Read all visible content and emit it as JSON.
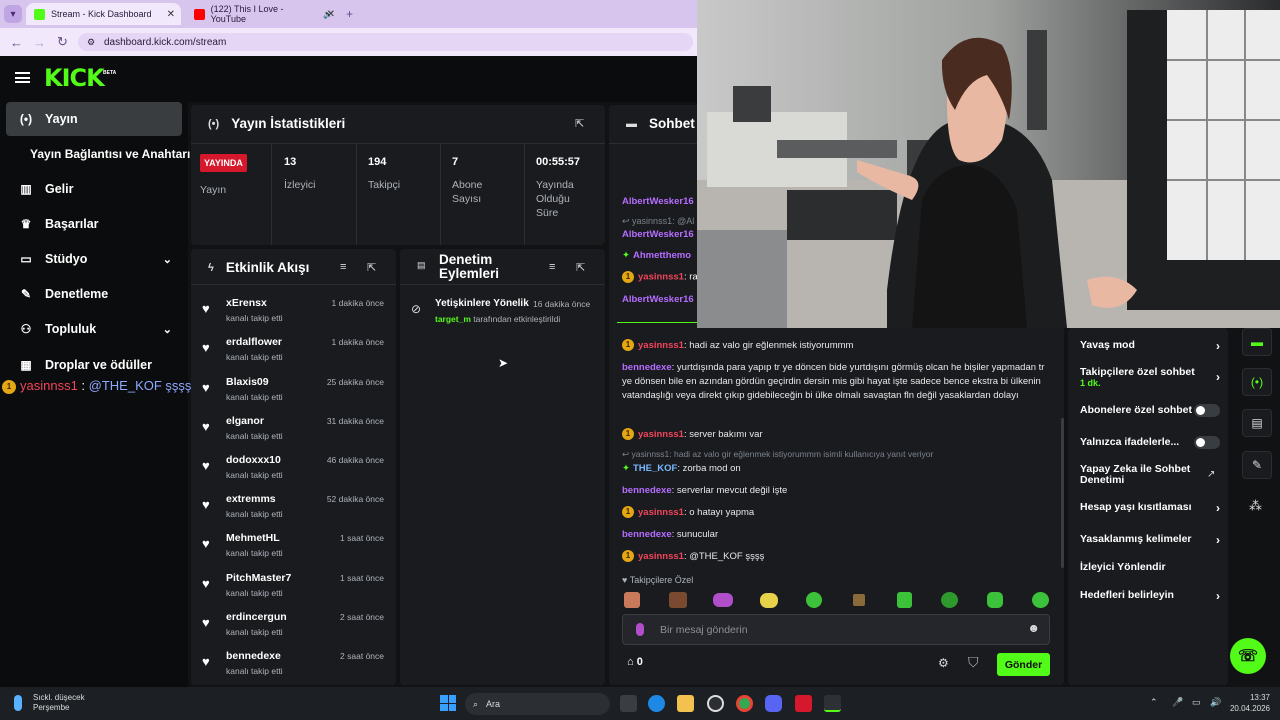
{
  "browser": {
    "tabs": [
      {
        "title": "Stream - Kick Dashboard",
        "active": true
      },
      {
        "title": "(122) This I Love - YouTube",
        "active": false
      }
    ],
    "url": "dashboard.kick.com/stream"
  },
  "brand": {
    "logo": "KICK",
    "beta": "BETA",
    "accent": "#53fc18"
  },
  "sidebar": {
    "items": [
      {
        "label": "Yayın",
        "icon": "broadcast-icon"
      },
      {
        "label": "Yayın Bağlantısı ve Anahtarı",
        "icon": ""
      },
      {
        "label": "Gelir",
        "icon": "bar-chart-icon"
      },
      {
        "label": "Başarılar",
        "icon": "trophy-icon"
      },
      {
        "label": "Stüdyo",
        "icon": "studio-icon"
      },
      {
        "label": "Denetleme",
        "icon": "wrench-icon"
      },
      {
        "label": "Topluluk",
        "icon": "users-icon"
      },
      {
        "label": "Droplar ve ödüller",
        "icon": "gift-icon"
      }
    ]
  },
  "overlay_chat": {
    "user": "yasinnss1",
    "sep": " : ",
    "text": "@THE_KOF şşşş"
  },
  "stats": {
    "title": "Yayın İstatistikleri",
    "live_badge": "YAYINDA",
    "live_label": "Yayın",
    "items": [
      {
        "value": "13",
        "label": "İzleyici"
      },
      {
        "value": "194",
        "label": "Takipçi"
      },
      {
        "value": "7",
        "label": "Abone Sayısı"
      },
      {
        "value": "00:55:57",
        "label": "Yayında Olduğu Süre"
      }
    ]
  },
  "activity": {
    "title": "Etkinlik Akışı",
    "items": [
      {
        "name": "xErensx",
        "sub": "kanalı takip etti",
        "time": "1 dakika önce"
      },
      {
        "name": "erdalflower",
        "sub": "kanalı takip etti",
        "time": "1 dakika önce"
      },
      {
        "name": "Blaxis09",
        "sub": "kanalı takip etti",
        "time": "25 dakika önce"
      },
      {
        "name": "elganor",
        "sub": "kanalı takip etti",
        "time": "31 dakika önce"
      },
      {
        "name": "dodoxxx10",
        "sub": "kanalı takip etti",
        "time": "46 dakika önce"
      },
      {
        "name": "extremms",
        "sub": "kanalı takip etti",
        "time": "52 dakika önce"
      },
      {
        "name": "MehmetHL",
        "sub": "kanalı takip etti",
        "time": "1 saat önce"
      },
      {
        "name": "PitchMaster7",
        "sub": "kanalı takip etti",
        "time": "1 saat önce"
      },
      {
        "name": "erdincergun",
        "sub": "kanalı takip etti",
        "time": "2 saat önce"
      },
      {
        "name": "bennedexe",
        "sub": "kanalı takip etti",
        "time": "2 saat önce"
      }
    ]
  },
  "moderation": {
    "title_line1": "Denetim",
    "title_line2": "Eylemleri",
    "item": {
      "title": "Yetişkinlere Yönelik",
      "time": "16 dakika önce",
      "actor": "target_m",
      "action": " tarafından etkinleştirildi"
    }
  },
  "chat": {
    "title": "Sohbet",
    "top_cut": [
      {
        "text": "AlbertWesker16"
      },
      {
        "reply": "yasinnss1: @Al"
      },
      {
        "user": "AlbertWesker16"
      },
      {
        "user": "Ahmetthemo"
      },
      {
        "user": "yasinnss1",
        "text": ": ra"
      },
      {
        "user": "AlbertWesker16"
      }
    ],
    "messages": [
      {
        "user": "yasinnss1",
        "text": ": hadi az valo gir eğlenmek istiyorummm"
      },
      {
        "user": "bennedexe",
        "text": ": yurtdışında para yapıp tr ye döncen bide yurtdışını görmüş olcan he bişiler yapmadan tr ye dönsen bile en azından gördün geçirdin dersin mis gibi hayat işte sadece bence ekstra bi ülkenin vatandaşlığı veya direkt çıkıp gidebileceğin bi ülke olmalı savaştan fln değil yasaklardan dolayı"
      },
      {
        "user": "yasinnss1",
        "text": ": server bakımı var"
      },
      {
        "reply": "yasinnss1: hadi az valo gir eğlenmek istiyorummm isimli kullanıcıya yanıt veriyor",
        "user": "THE_KOF",
        "text": ": zorba mod on"
      },
      {
        "user": "bennedexe",
        "text": ": serverlar mevcut değil işte"
      },
      {
        "user": "yasinnss1",
        "text": ": o hatayı yapma"
      },
      {
        "user": "bennedexe",
        "text": ": sunucular"
      },
      {
        "user": "yasinnss1",
        "text": ": @THE_KOF şşşş"
      }
    ],
    "emote_header": "Takipçilere Özel",
    "input_placeholder": "Bir mesaj gönderin",
    "points": "0",
    "send_label": "Gönder"
  },
  "settings": {
    "items": [
      {
        "label": "Yavaş mod",
        "control": "chevron"
      },
      {
        "label": "Takipçilere özel sohbet",
        "sub": "1 dk.",
        "control": "chevron"
      },
      {
        "label": "Abonelere özel sohbet",
        "control": "toggle"
      },
      {
        "label": "Yalnızca ifadelerle...",
        "control": "toggle"
      },
      {
        "label": "Yapay Zeka ile Sohbet Denetimi",
        "control": "external"
      },
      {
        "label": "Hesap yaşı kısıtlaması",
        "control": "chevron"
      },
      {
        "label": "Yasaklanmış kelimeler",
        "control": "chevron"
      },
      {
        "label": "İzleyici Yönlendir",
        "control": "none"
      },
      {
        "label": "Hedefleri belirleyin",
        "control": "chevron"
      }
    ]
  },
  "taskbar": {
    "weather_title": "Sıckl. düşecek",
    "weather_sub": "Perşembe",
    "search": "Ara",
    "time": "13:37",
    "date": "20.04.2026"
  }
}
